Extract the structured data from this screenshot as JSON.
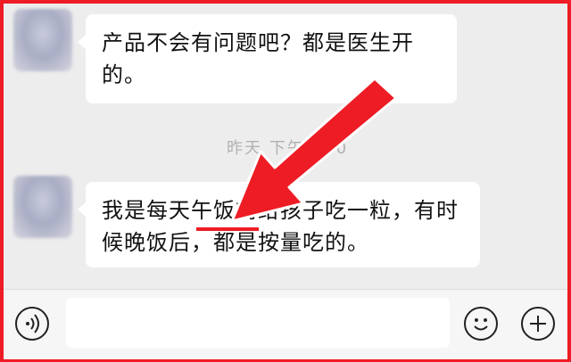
{
  "messages": [
    {
      "text": "产品不会有问题吧？都是医生开的。"
    },
    {
      "text": "我是每天午饭前给孩子吃一粒，有时候晚饭后，都是按量吃的。"
    }
  ],
  "timestamp": "昨天 下午8:20",
  "annotation": {
    "color": "#ee1c25",
    "arrow-icon": "red-arrow",
    "underline_target": "午饭前"
  },
  "input_bar": {
    "placeholder": "",
    "icons": [
      "voice-icon",
      "emoji-icon",
      "plus-icon"
    ]
  },
  "colors": {
    "background": "#ededed",
    "bubble": "#ffffff",
    "frame": "#ee1c25"
  }
}
